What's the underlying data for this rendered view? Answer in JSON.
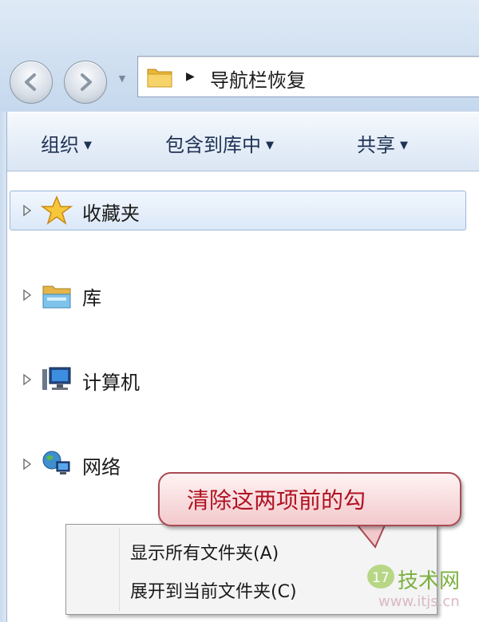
{
  "address_bar": {
    "path": "导航栏恢复"
  },
  "toolbar": {
    "organize": "组织",
    "include_in_library": "包含到库中",
    "share": "共享"
  },
  "nav_pane": {
    "items": [
      {
        "label": "收藏夹",
        "icon": "star-icon",
        "selected": true
      },
      {
        "label": "库",
        "icon": "library-icon"
      },
      {
        "label": "计算机",
        "icon": "computer-icon"
      },
      {
        "label": "网络",
        "icon": "network-icon"
      }
    ]
  },
  "context_menu": {
    "items": [
      "显示所有文件夹(A)",
      "展开到当前文件夹(C)"
    ]
  },
  "callout": {
    "text": "清除这两项前的勾"
  },
  "watermark": {
    "brand": "技术网",
    "mark": "17",
    "url": "www.itjs.cn"
  },
  "colors": {
    "callout_text": "#b01222",
    "selection": "#dbe8f8",
    "toolbar_text": "#1e3254"
  }
}
